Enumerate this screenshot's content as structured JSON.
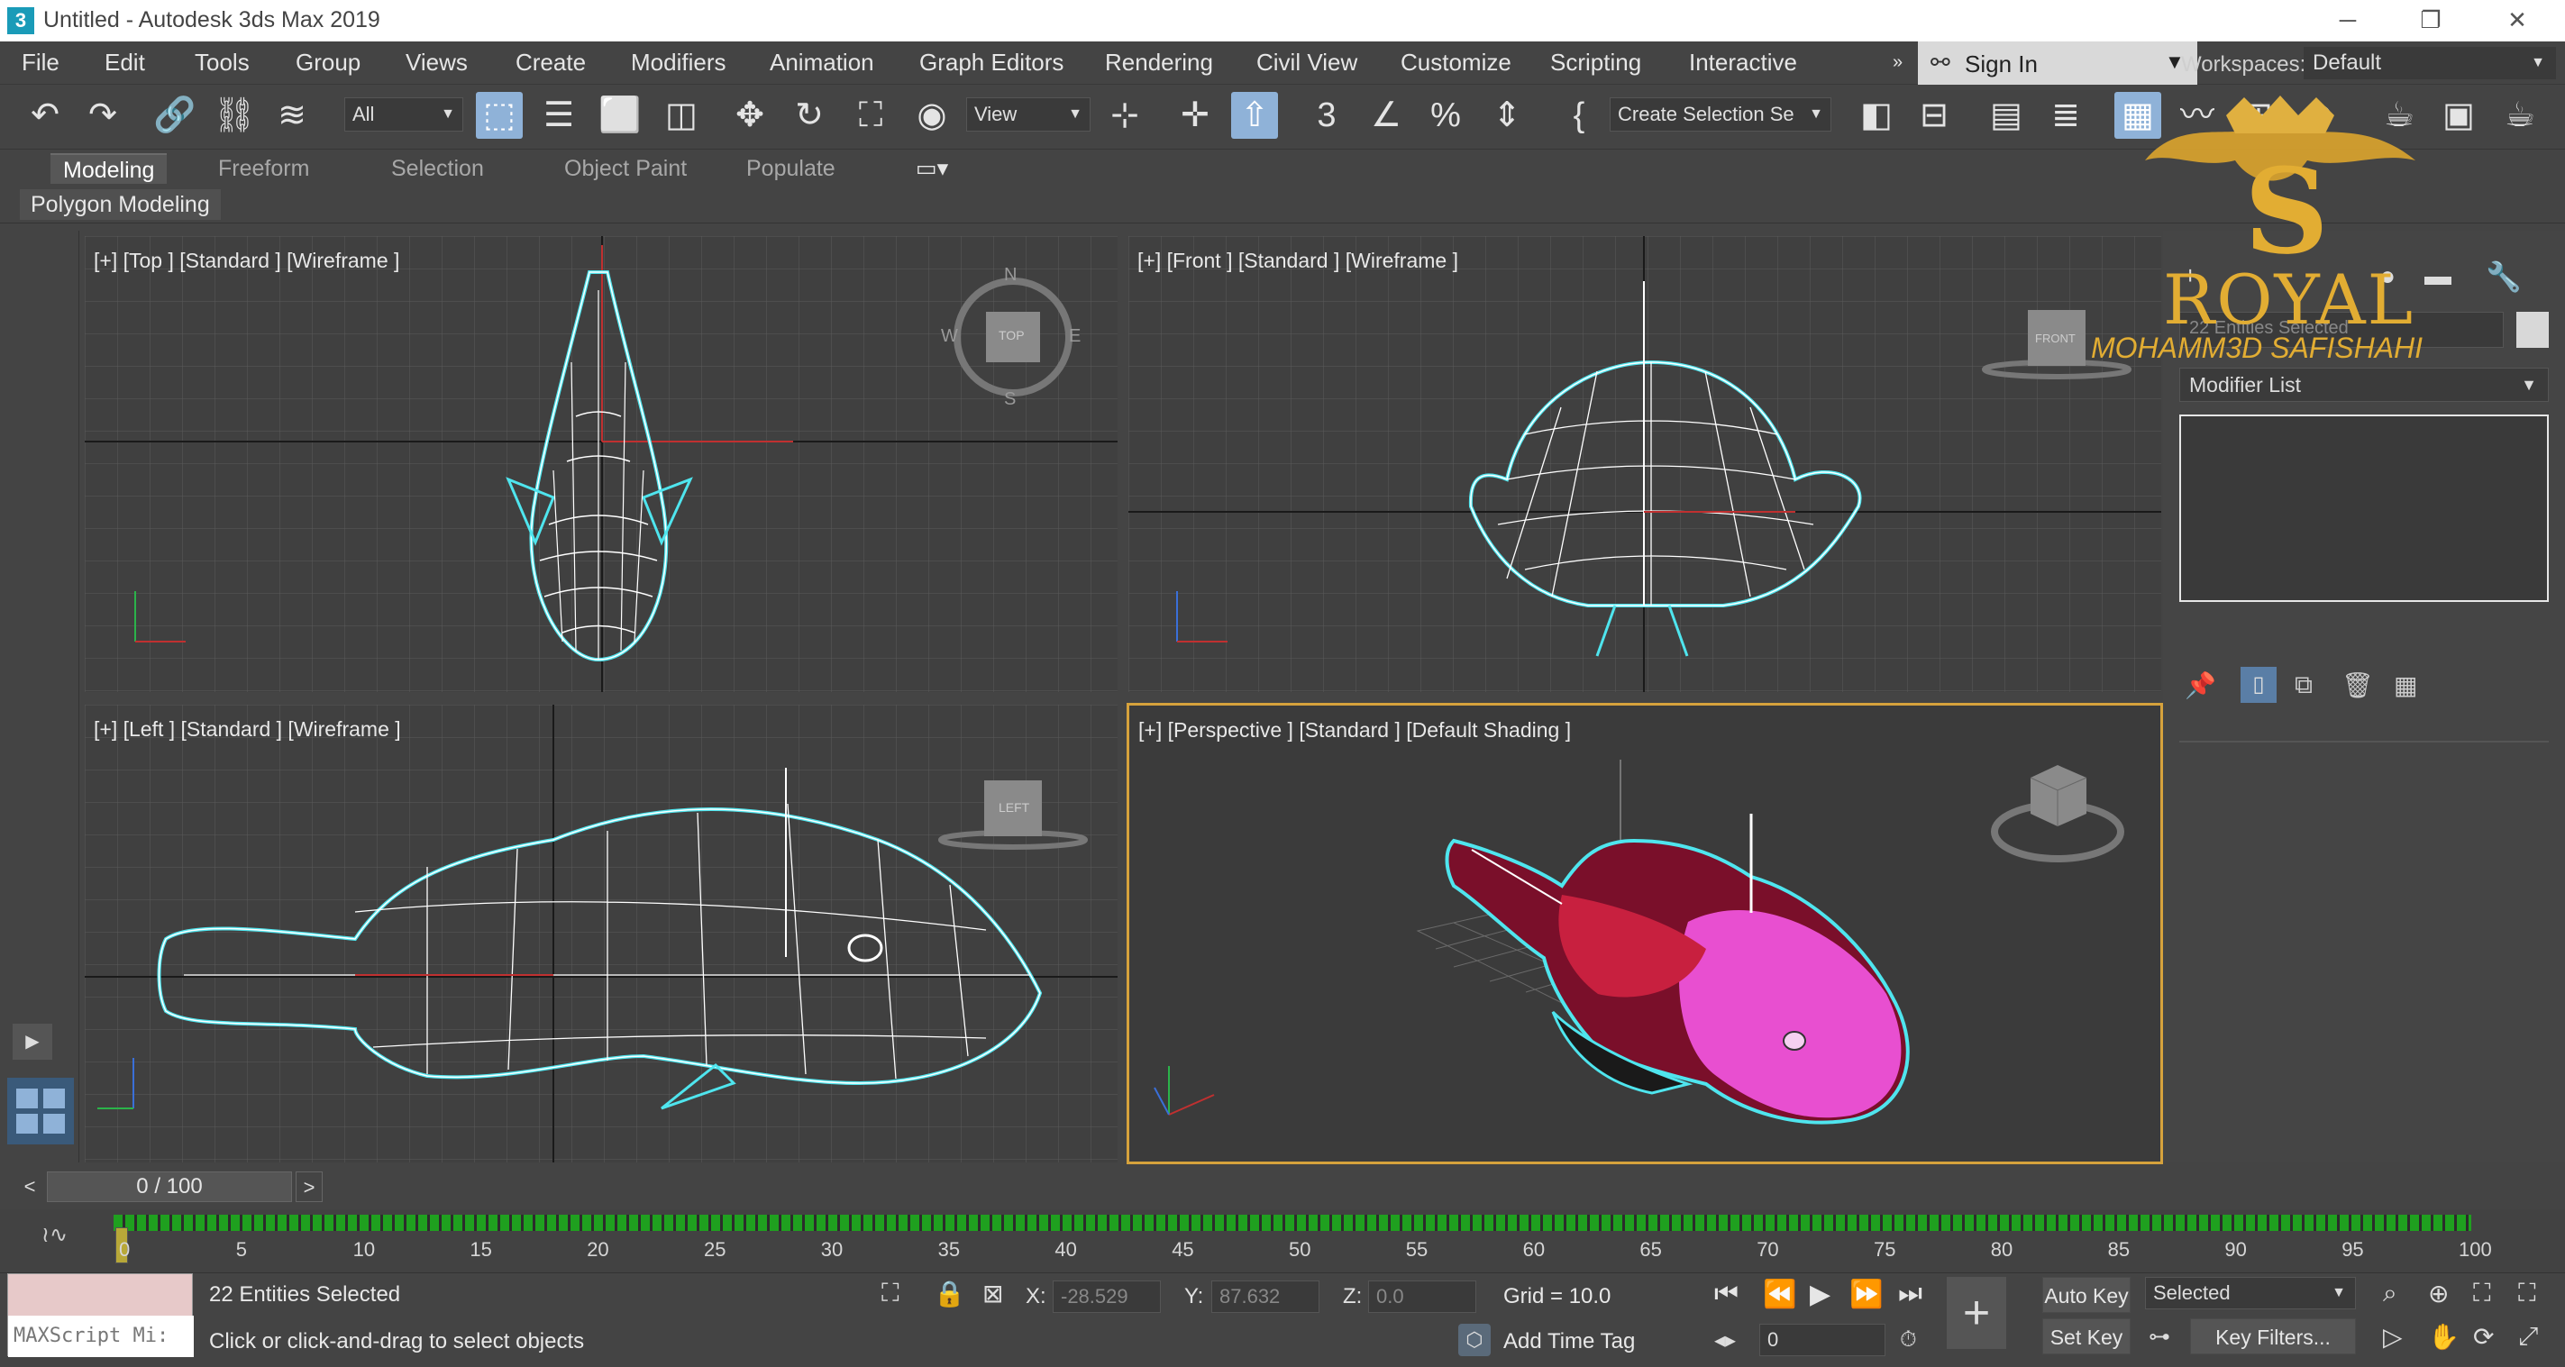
{
  "window": {
    "app_icon": "3",
    "title": "Untitled - Autodesk 3ds Max 2019",
    "minimize": "─",
    "restore": "❐",
    "close": "✕"
  },
  "menu": [
    "File",
    "Edit",
    "Tools",
    "Group",
    "Views",
    "Create",
    "Modifiers",
    "Animation",
    "Graph Editors",
    "Rendering",
    "Civil View",
    "Customize",
    "Scripting",
    "Interactive"
  ],
  "account": {
    "sign_in": "Sign In",
    "workspaces_label": "Workspaces:",
    "workspace": "Default"
  },
  "toolbar": {
    "selection_filter": "All",
    "ref_coord": "View",
    "named_selection": "Create Selection Se"
  },
  "ribbon": {
    "tabs": [
      "Modeling",
      "Freeform",
      "Selection",
      "Object Paint",
      "Populate"
    ],
    "active_tab": "Modeling",
    "panel": "Polygon Modeling"
  },
  "viewports": {
    "top": "[+] [Top ] [Standard ] [Wireframe ]",
    "front": "[+] [Front ] [Standard ] [Wireframe ]",
    "left": "[+] [Left ] [Standard ] [Wireframe ]",
    "perspective": "[+] [Perspective ] [Standard ] [Default Shading ]",
    "viewcube_top": "TOP",
    "viewcube_front": "FRONT",
    "viewcube_left": "LEFT",
    "compass": {
      "n": "N",
      "s": "S",
      "e": "E",
      "w": "W"
    }
  },
  "command_panel": {
    "name_field": "22 Entities Selected",
    "modifier_list": "Modifier List"
  },
  "watermark": {
    "brand": "ROYAL",
    "author": "MOHAMM3D SAFISHAHI",
    "logo_letter": "S"
  },
  "timeline": {
    "frame_display": "0 / 100",
    "ticks": [
      "0",
      "5",
      "10",
      "15",
      "20",
      "25",
      "30",
      "35",
      "40",
      "45",
      "50",
      "55",
      "60",
      "65",
      "70",
      "75",
      "80",
      "85",
      "90",
      "95",
      "100"
    ]
  },
  "status": {
    "maxscript_label": "MAXScript Mi:",
    "selection_info": "22 Entities Selected",
    "prompt": "Click or click-and-drag to select objects",
    "x_label": "X:",
    "x_value": "-28.529",
    "y_label": "Y:",
    "y_value": "87.632",
    "z_label": "Z:",
    "z_value": "0.0",
    "grid": "Grid = 10.0",
    "add_time_tag": "Add Time Tag",
    "auto_key": "Auto Key",
    "set_key": "Set Key",
    "key_mode": "Selected",
    "key_filters": "Key Filters...",
    "current_frame": "0"
  }
}
